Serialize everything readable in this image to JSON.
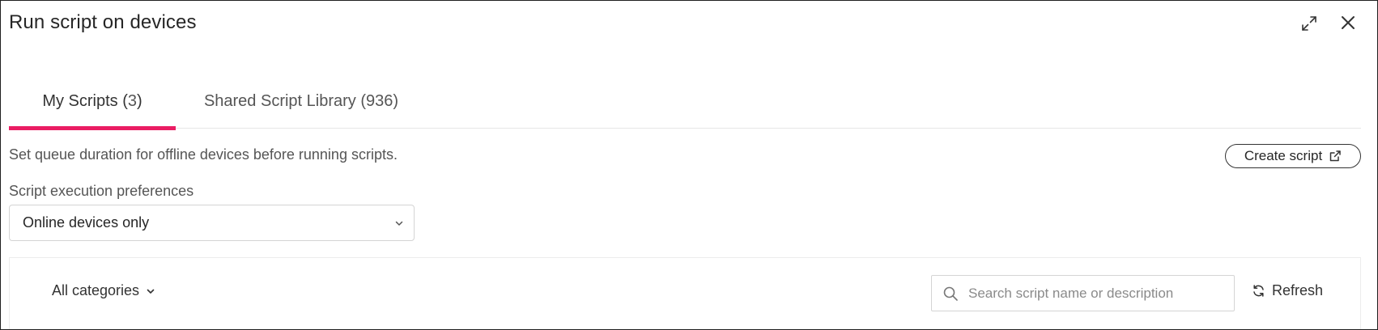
{
  "dialog": {
    "title": "Run script on devices",
    "actions": {
      "expand_icon": "expand-icon",
      "close_icon": "close-icon"
    }
  },
  "tabs": [
    {
      "label": "My Scripts (",
      "count": "3",
      "suffix": ")",
      "active": true
    },
    {
      "label": "Shared Script Library (936)",
      "active": false
    }
  ],
  "info": {
    "text": "Set queue duration for offline devices before running scripts.",
    "create_button": {
      "label": "Create script",
      "icon": "external-link-icon"
    }
  },
  "preferences": {
    "label": "Script execution preferences",
    "selected": "Online devices only",
    "icon": "chevron-down-icon"
  },
  "toolbar": {
    "categories": {
      "label": "All categories",
      "icon": "chevron-down-icon"
    },
    "search": {
      "placeholder": "Search script name or description",
      "value": "",
      "icon": "search-icon"
    },
    "refresh": {
      "label": "Refresh",
      "icon": "refresh-icon"
    }
  },
  "colors": {
    "accent": "#ea1d63",
    "border": "#d4d4d4",
    "text": "#333333"
  }
}
